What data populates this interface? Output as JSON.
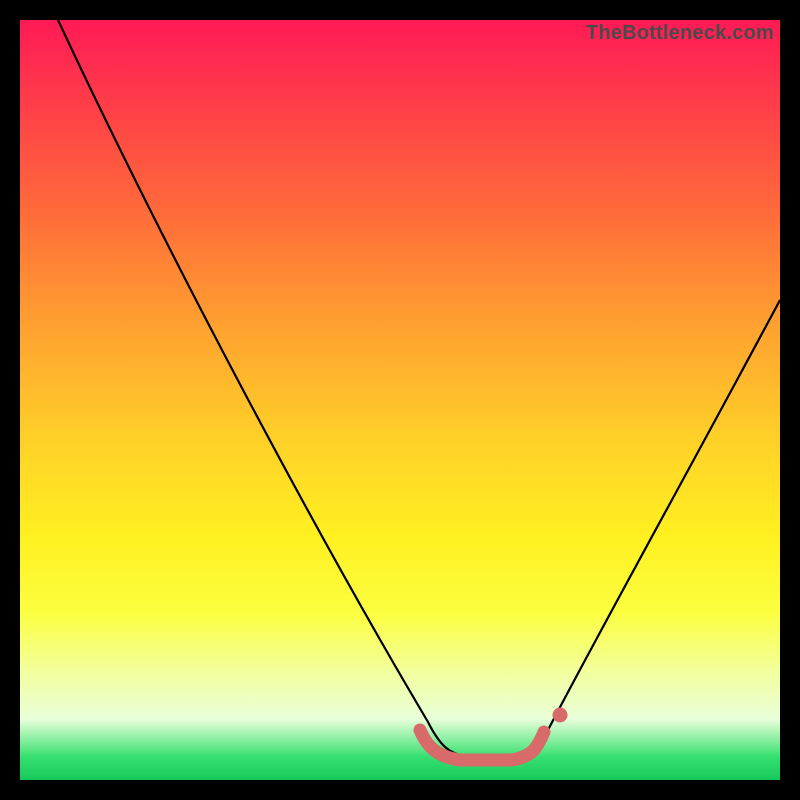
{
  "watermark": "TheBottleneck.com",
  "chart_data": {
    "type": "line",
    "title": "",
    "xlabel": "",
    "ylabel": "",
    "xlim": [
      0,
      100
    ],
    "ylim": [
      0,
      100
    ],
    "grid": false,
    "legend": false,
    "series": [
      {
        "name": "bottleneck-curve",
        "x": [
          5,
          10,
          15,
          20,
          25,
          30,
          35,
          40,
          45,
          50,
          54,
          58,
          60,
          62,
          64,
          68,
          72,
          76,
          80,
          84,
          88,
          92,
          96,
          100
        ],
        "y": [
          100,
          90,
          80,
          70,
          60,
          50,
          42,
          34,
          26,
          18,
          10,
          5,
          4,
          4,
          4,
          5,
          8,
          13,
          20,
          28,
          36,
          45,
          54,
          63
        ]
      }
    ],
    "annotations": {
      "optimal_zone_x": [
        54,
        68
      ],
      "optimal_zone_y": 4
    },
    "background_gradient": {
      "top": "#ff1a55",
      "mid": "#fff020",
      "bottom": "#16c85a"
    },
    "highlight_color": "#d86a6a"
  }
}
